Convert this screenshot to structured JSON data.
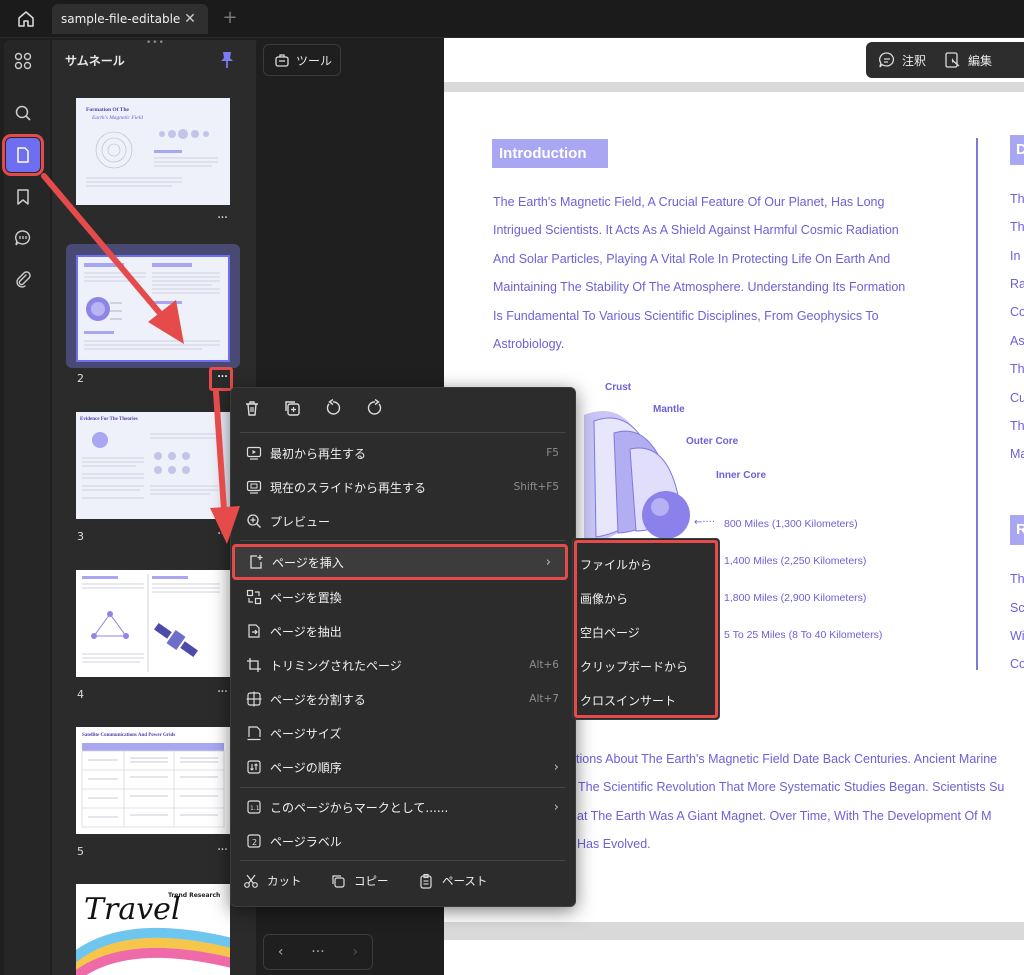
{
  "titlebar": {
    "tab_label": "sample-file-editable",
    "tab_close": "✕",
    "tab_add": "+"
  },
  "thumbnails": {
    "title": "サムネール",
    "more": "···",
    "pages": [
      {
        "num": "",
        "heading": "Formation Of The",
        "subheading": "Earth's Magnetic Field"
      },
      {
        "num": "2"
      },
      {
        "num": "3",
        "heading": "Evidence For The Theories"
      },
      {
        "num": "4"
      },
      {
        "num": "5",
        "heading": "Satellite Communications And Power Grids"
      },
      {
        "num": "",
        "heading": "Travel",
        "subheading": "Trend Research"
      }
    ]
  },
  "tools": {
    "label": "ツール"
  },
  "pager": {
    "prev": "‹",
    "dots": "···",
    "next": "›"
  },
  "annotation_bar": {
    "annotate": "注釈",
    "edit": "編集"
  },
  "document": {
    "intro_title": "Introduction",
    "intro_lines": [
      "The Earth's Magnetic Field, A Crucial Feature Of Our Planet, Has Long",
      "Intrigued Scientists. It Acts As A Shield Against Harmful Cosmic Radiation",
      "And Solar Particles, Playing A Vital Role In Protecting Life On Earth And",
      "Maintaining The Stability Of The Atmosphere. Understanding Its Formation",
      "Is Fundamental To Various Scientific Disciplines, From Geophysics To",
      "Astrobiology."
    ],
    "layers": {
      "crust": "Crust",
      "mantle": "Mantle",
      "outer_core": "Outer Core",
      "inner_core": "Inner Core"
    },
    "miles": [
      "800 Miles (1,300 Kilometers)",
      "1,400 Miles (2,250 Kilometers)",
      "1,800 Miles (2,900 Kilometers)",
      "5 To 25 Miles (8 To 40 Kilometers)"
    ],
    "right_col_badge": "D",
    "right_col_lines": [
      "Th",
      "Th",
      "In",
      "Ra",
      "Co",
      "As",
      "Th",
      "Cu",
      "Th",
      "Ma"
    ],
    "right_col_badge2": "R",
    "right_col_lines2": [
      "Th",
      "Sc",
      "Wi",
      "Co"
    ],
    "bottom_lines": [
      "tions About The Earth's Magnetic Field Date Back Centuries. Ancient Marine",
      "The Scientific Revolution That More Systematic Studies Began. Scientists Su",
      "at The Earth Was A Giant Magnet. Over Time, With The Development Of M",
      "Has Evolved."
    ]
  },
  "context_menu": {
    "items": [
      {
        "label": "最初から再生する",
        "shortcut": "F5"
      },
      {
        "label": "現在のスライドから再生する",
        "shortcut": "Shift+F5"
      },
      {
        "label": "プレビュー",
        "shortcut": ""
      },
      {
        "label": "ページを挿入",
        "shortcut": ""
      },
      {
        "label": "ページを置換",
        "shortcut": ""
      },
      {
        "label": "ページを抽出",
        "shortcut": ""
      },
      {
        "label": "トリミングされたページ",
        "shortcut": "Alt+6"
      },
      {
        "label": "ページを分割する",
        "shortcut": "Alt+7"
      },
      {
        "label": "ページサイズ",
        "shortcut": ""
      },
      {
        "label": "ページの順序",
        "shortcut": ""
      },
      {
        "label": "このページからマークとして......",
        "shortcut": ""
      },
      {
        "label": "ページラベル",
        "shortcut": ""
      }
    ],
    "cut": "カット",
    "copy": "コピー",
    "paste": "ペースト",
    "arrow": "›"
  },
  "submenu": {
    "items": [
      "ファイルから",
      "画像から",
      "空白ページ",
      "クリップボードから",
      "クロスインサート"
    ]
  },
  "colors": {
    "accent": "#6e6ef0",
    "highlight": "#e54b4b",
    "doc_text": "#6d61d8"
  }
}
